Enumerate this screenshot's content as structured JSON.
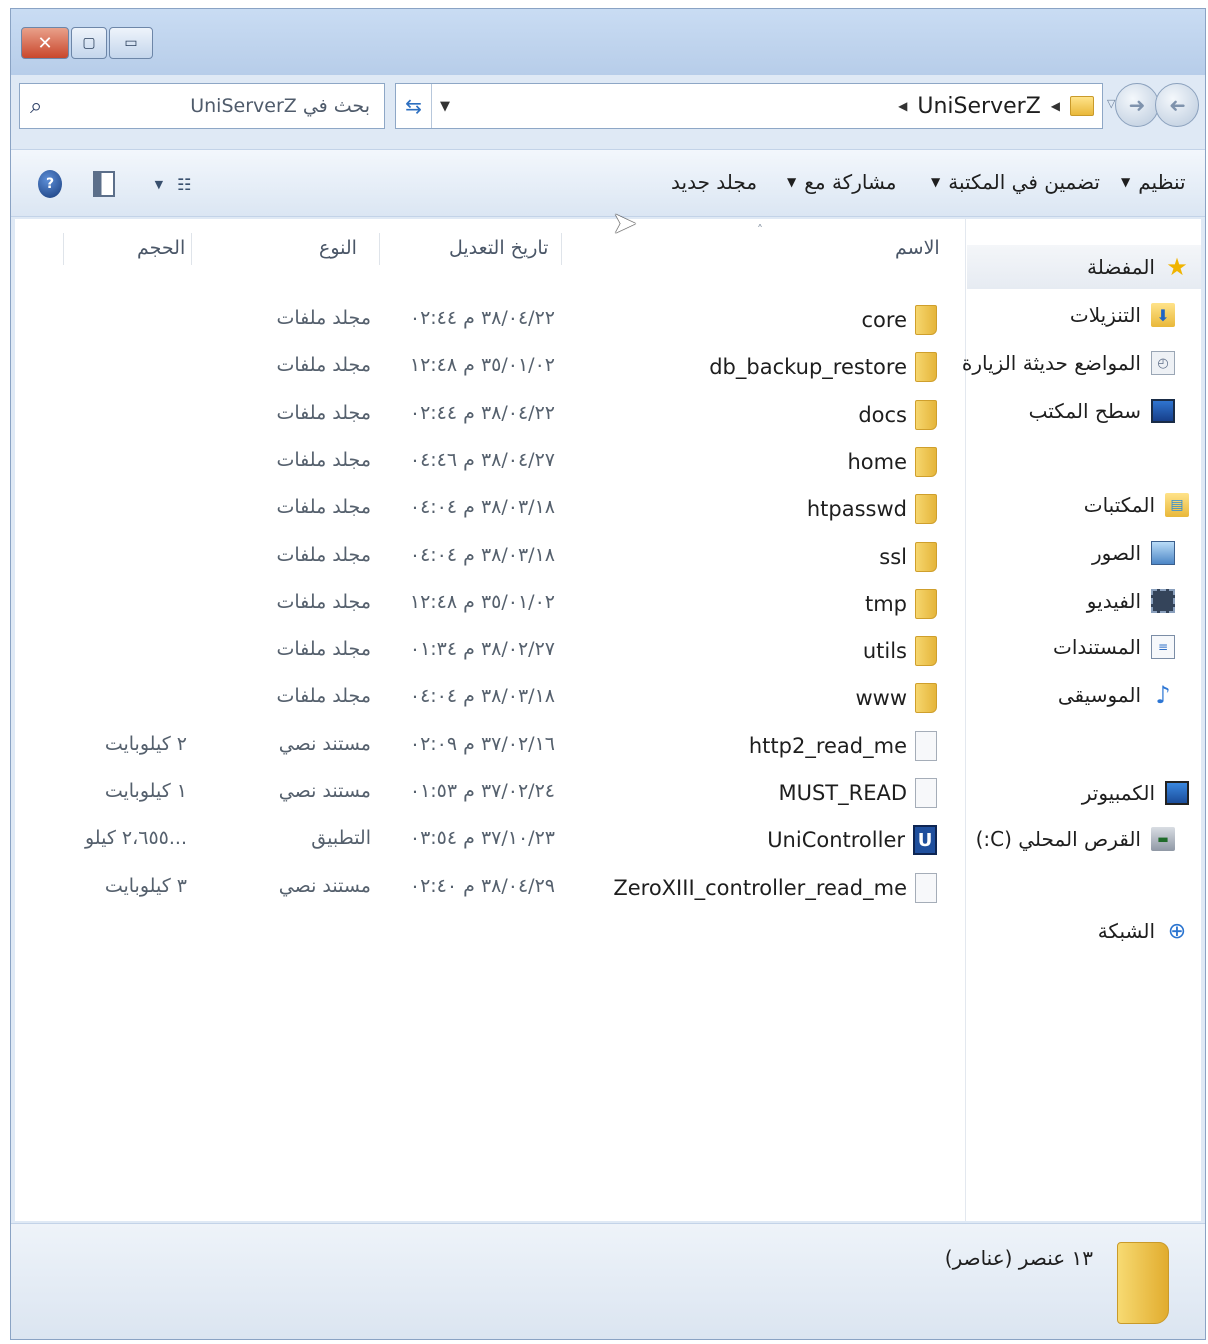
{
  "window": {
    "caption_buttons": [
      "close-icon",
      "maximize-icon",
      "minimize-icon"
    ]
  },
  "address": {
    "search_placeholder": "بحث في UniServerZ",
    "path": [
      "UniServerZ"
    ]
  },
  "toolbar": {
    "organize": "تنظيم",
    "include_library": "تضمين في المكتبة",
    "share_with": "مشاركة مع",
    "new_folder": "مجلد جديد"
  },
  "nav": {
    "favorites": "المفضلة",
    "downloads": "التنزيلات",
    "recent_places": "المواضع حديثة الزيارة",
    "desktop": "سطح المكتب",
    "libraries": "المكتبات",
    "pictures": "الصور",
    "videos": "الفيديو",
    "documents": "المستندات",
    "music": "الموسيقى",
    "computer": "الكمبيوتر",
    "local_disk": "القرص المحلي (C:)",
    "network": "الشبكة"
  },
  "columns": {
    "name": "الاسم",
    "date_modified": "تاريخ التعديل",
    "type": "النوع",
    "size": "الحجم"
  },
  "files": [
    {
      "name": "core",
      "date": "٣٨/٠٤/٢٢ م ٠٢:٤٤",
      "type": "مجلد ملفات",
      "size": "",
      "icon": "folder-icon"
    },
    {
      "name": "db_backup_restore",
      "date": "٣٥/٠١/٠٢ م ١٢:٤٨",
      "type": "مجلد ملفات",
      "size": "",
      "icon": "folder-icon"
    },
    {
      "name": "docs",
      "date": "٣٨/٠٤/٢٢ م ٠٢:٤٤",
      "type": "مجلد ملفات",
      "size": "",
      "icon": "folder-icon"
    },
    {
      "name": "home",
      "date": "٣٨/٠٤/٢٧ م ٠٤:٤٦",
      "type": "مجلد ملفات",
      "size": "",
      "icon": "folder-icon"
    },
    {
      "name": "htpasswd",
      "date": "٣٨/٠٣/١٨ م ٠٤:٠٤",
      "type": "مجلد ملفات",
      "size": "",
      "icon": "folder-icon"
    },
    {
      "name": "ssl",
      "date": "٣٨/٠٣/١٨ م ٠٤:٠٤",
      "type": "مجلد ملفات",
      "size": "",
      "icon": "folder-icon"
    },
    {
      "name": "tmp",
      "date": "٣٥/٠١/٠٢ م ١٢:٤٨",
      "type": "مجلد ملفات",
      "size": "",
      "icon": "folder-icon"
    },
    {
      "name": "utils",
      "date": "٣٨/٠٢/٢٧ م ٠١:٣٤",
      "type": "مجلد ملفات",
      "size": "",
      "icon": "folder-icon"
    },
    {
      "name": "www",
      "date": "٣٨/٠٣/١٨ م ٠٤:٠٤",
      "type": "مجلد ملفات",
      "size": "",
      "icon": "folder-icon"
    },
    {
      "name": "http2_read_me",
      "date": "٣٧/٠٢/١٦ م ٠٢:٠٩",
      "type": "مستند نصي",
      "size": "٢ كيلوبايت",
      "icon": "text-file-icon"
    },
    {
      "name": "MUST_READ",
      "date": "٣٧/٠٢/٢٤ م ٠١:٥٣",
      "type": "مستند نصي",
      "size": "١ كيلوبايت",
      "icon": "text-file-icon"
    },
    {
      "name": "UniController",
      "date": "٣٧/١٠/٢٣ م ٠٣:٥٤",
      "type": "التطبيق",
      "size": "...٢،٦٥٥ كيلو",
      "icon": "app-icon"
    },
    {
      "name": "ZeroXIII_controller_read_me",
      "date": "٣٨/٠٤/٢٩ م ٠٢:٤٠",
      "type": "مستند نصي",
      "size": "٣ كيلوبايت",
      "icon": "text-file-icon"
    }
  ],
  "status": {
    "item_count": "١٣ عنصر (عناصر)"
  }
}
